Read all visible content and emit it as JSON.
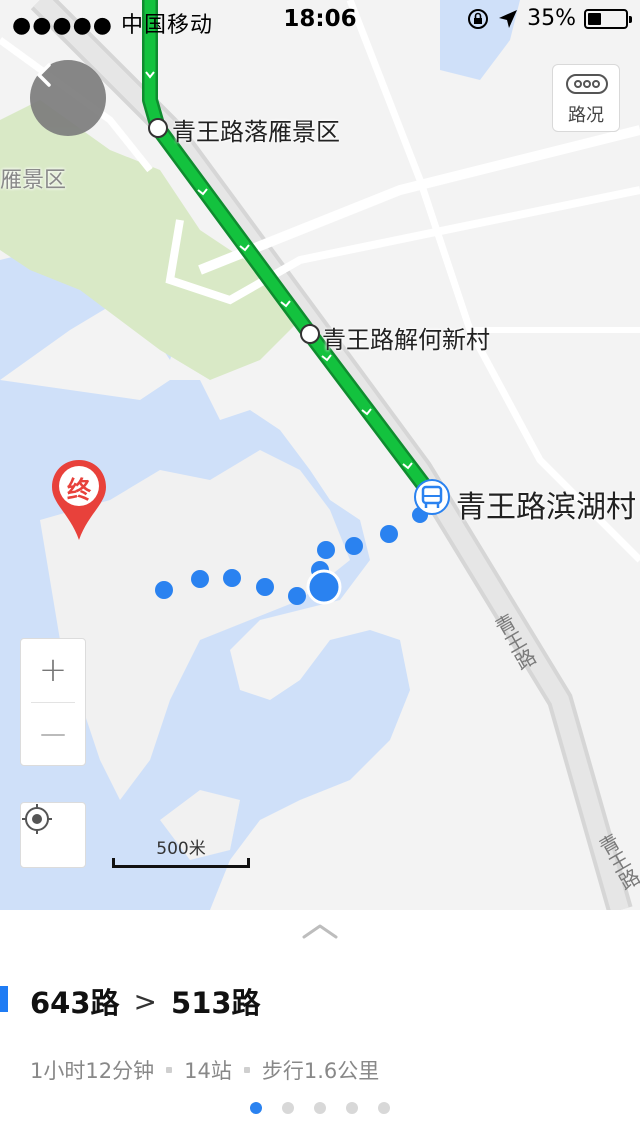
{
  "status_bar": {
    "carrier": "●●●●● 中国移动",
    "time": "18:06",
    "battery": "35%",
    "battery_level": 0.35
  },
  "map": {
    "traffic_label": "路况",
    "stops": [
      "青王路落雁景区",
      "青王路解何新村",
      "青王路滨湖村"
    ],
    "faint_label": "雁景区",
    "road_label": "青王路",
    "road_label_2": "青王路",
    "end_marker": "终",
    "scale_label": "500米",
    "zoom_in": "+",
    "zoom_out": "—"
  },
  "sheet": {
    "route_from": "643路",
    "route_to": "513路",
    "route_arrow": ">",
    "duration": "1小时12分钟",
    "stops": "14站",
    "walk": "步行1.6公里",
    "pages": 5,
    "active_page": 1
  },
  "colors": {
    "route_green": "#12b33a",
    "walk_blue": "#2a82f0",
    "water": "#cfe0f9",
    "park": "#d9e9c6",
    "end_red": "#e8413b"
  }
}
